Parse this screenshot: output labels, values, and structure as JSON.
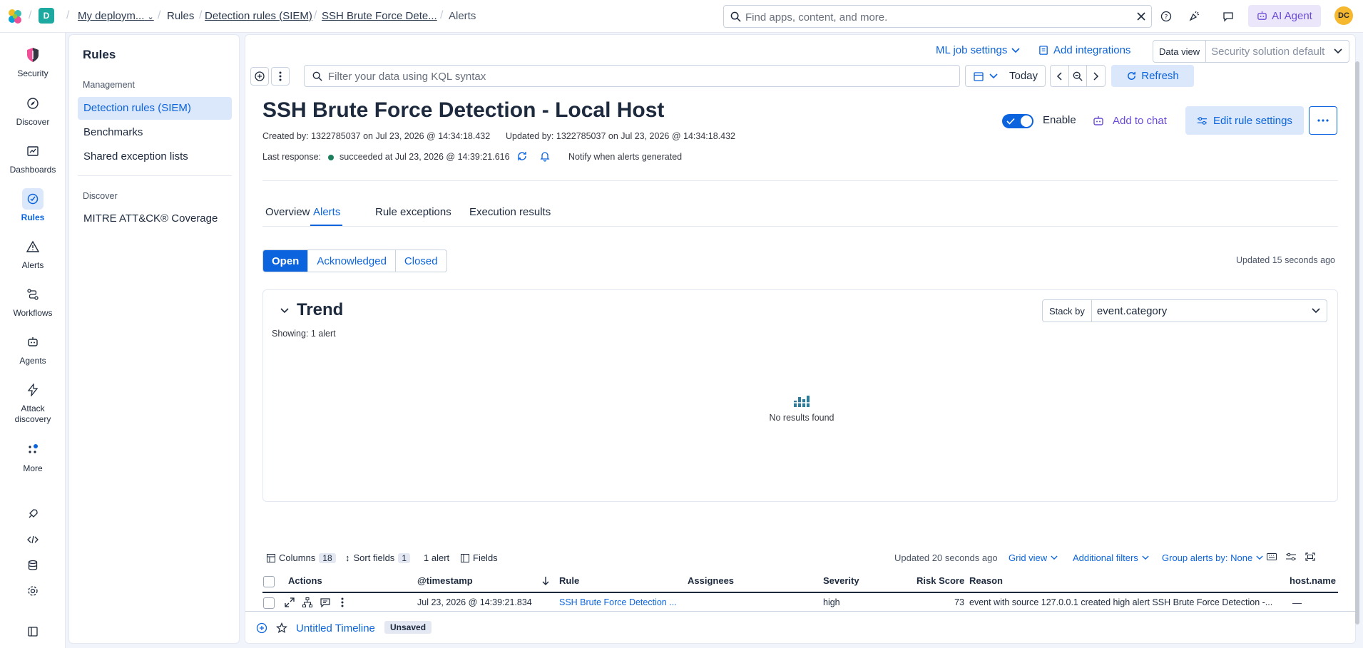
{
  "topbar": {
    "space_avatar": "D",
    "breadcrumbs": [
      "My deploym...",
      "Rules",
      "Detection rules (SIEM)",
      "SSH Brute Force Dete...",
      "Alerts"
    ],
    "search_placeholder": "Find apps, content, and more.",
    "ai_agent_label": "AI Agent",
    "user_initials": "DC"
  },
  "leftnav": {
    "items": [
      {
        "label": "Security",
        "icon": "security-icon"
      },
      {
        "label": "Discover",
        "icon": "discover-icon"
      },
      {
        "label": "Dashboards",
        "icon": "dashboards-icon"
      },
      {
        "label": "Rules",
        "icon": "rules-icon",
        "active": true
      },
      {
        "label": "Alerts",
        "icon": "alerts-icon"
      },
      {
        "label": "Workflows",
        "icon": "workflows-icon"
      },
      {
        "label": "Agents",
        "icon": "agents-icon"
      },
      {
        "label": "Attack discovery",
        "icon": "attack-discovery-icon"
      },
      {
        "label": "More",
        "icon": "more-icon"
      }
    ]
  },
  "secnav": {
    "title": "Rules",
    "groups": [
      {
        "label": "Management",
        "items": [
          "Detection rules (SIEM)",
          "Benchmarks",
          "Shared exception lists"
        ]
      },
      {
        "label": "Discover",
        "items": [
          "MITRE ATT&CK® Coverage"
        ]
      }
    ]
  },
  "header": {
    "ml_job_settings": "ML job settings",
    "add_integrations": "Add integrations",
    "data_view_label": "Data view",
    "data_view_value": "Security solution default"
  },
  "querybar": {
    "placeholder": "Filter your data using KQL syntax",
    "date_label": "Today",
    "refresh_label": "Refresh"
  },
  "rule": {
    "title": "SSH Brute Force Detection - Local Host",
    "created": "Created by: 1322785037 on Jul 23, 2026 @ 14:34:18.432",
    "updated": "Updated by: 1322785037 on Jul 23, 2026 @ 14:34:18.432",
    "last_response_label": "Last response:",
    "last_response_value": "succeeded at Jul 23, 2026 @ 14:39:21.616",
    "notify_label": "Notify when alerts generated",
    "enable_label": "Enable",
    "enabled": true,
    "add_to_chat": "Add to chat",
    "edit_settings": "Edit rule settings"
  },
  "tabs": [
    "Overview",
    "Alerts",
    "Rule exceptions",
    "Execution results"
  ],
  "status_filter": {
    "options": [
      "Open",
      "Acknowledged",
      "Closed"
    ],
    "selected": "Open",
    "updated": "Updated 15 seconds ago"
  },
  "trend": {
    "title": "Trend",
    "showing": "Showing: 1 alert",
    "stack_by_label": "Stack by",
    "stack_by_value": "event.category",
    "empty_text": "No results found"
  },
  "table": {
    "columns_label": "Columns",
    "columns_count": "18",
    "sort_label": "Sort fields",
    "sort_count": "1",
    "alert_count": "1 alert",
    "fields_label": "Fields",
    "updated": "Updated 20 seconds ago",
    "grid_view": "Grid view",
    "additional_filters": "Additional filters",
    "group_by": "Group alerts by: None",
    "headers": [
      "Actions",
      "@timestamp",
      "Rule",
      "Assignees",
      "Severity",
      "Risk Score",
      "Reason",
      "host.name"
    ],
    "rows": [
      {
        "timestamp": "Jul 23, 2026 @ 14:39:21.834",
        "rule": "SSH Brute Force Detection ...",
        "assignees": "",
        "severity": "high",
        "risk_score": "73",
        "reason": "event with source 127.0.0.1 created high alert SSH Brute Force Detection -...",
        "host_name": "—"
      }
    ]
  },
  "footer": {
    "timeline_title": "Untitled Timeline",
    "unsaved_label": "Unsaved"
  },
  "colors": {
    "accent": "#0b64dd",
    "accent_light": "#dbe7fb",
    "ai_purple": "#6a4bd8",
    "success": "#1e7f5c",
    "avatar_yellow": "#f5b82e",
    "space_teal": "#1ba9a0"
  }
}
